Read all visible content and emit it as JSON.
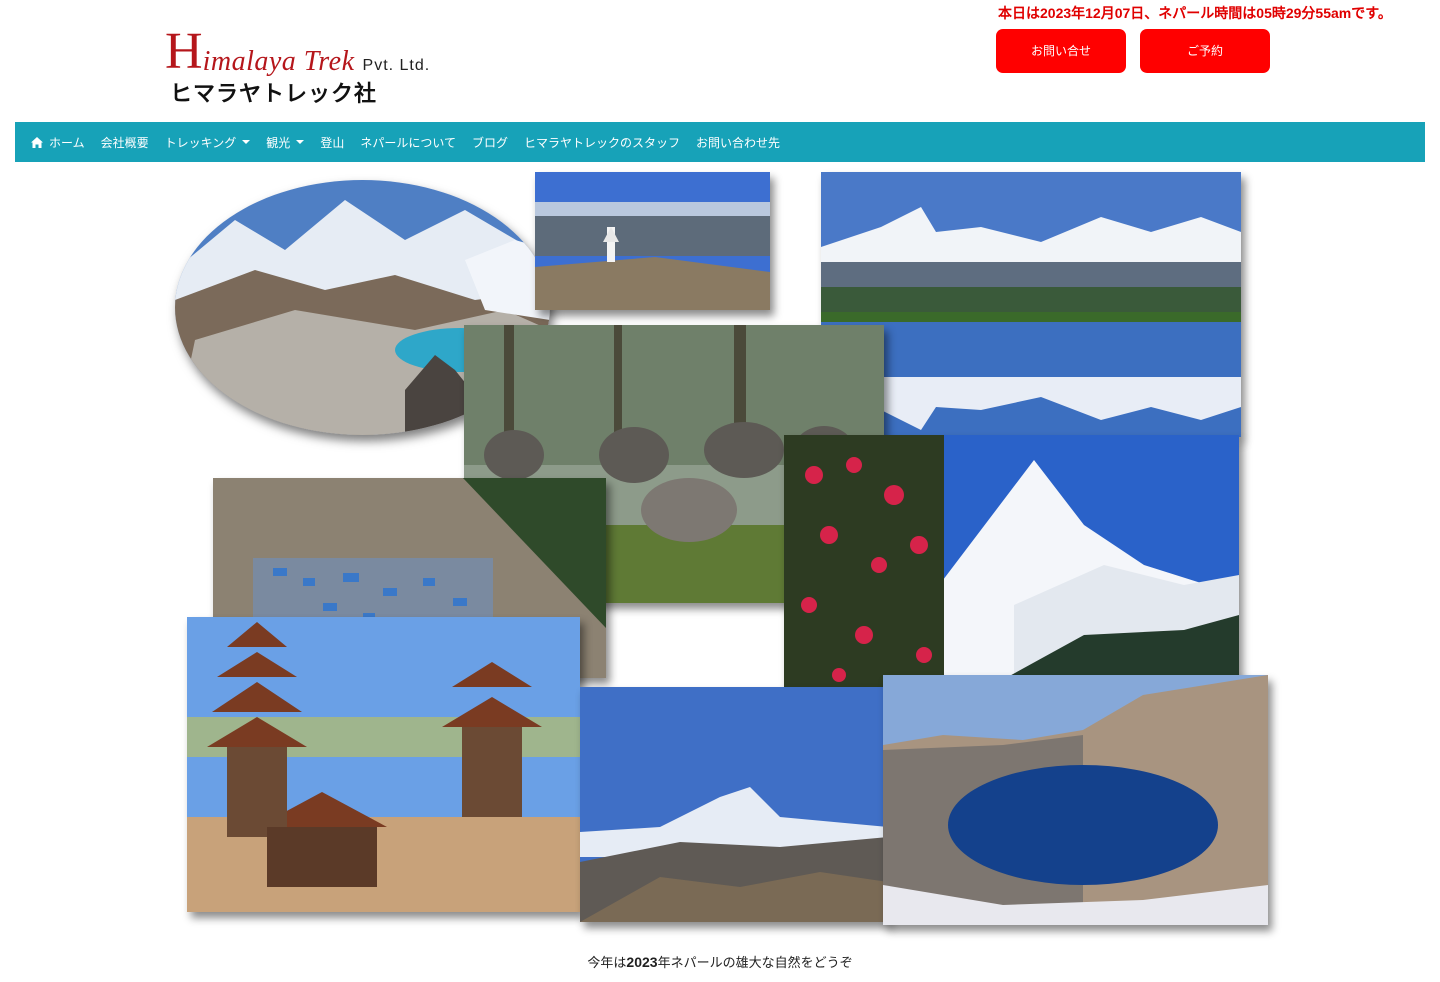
{
  "header": {
    "logo_initial": "H",
    "logo_rest": "imalaya Trek",
    "logo_suffix": "Pvt. Ltd.",
    "logo_japanese": "ヒマラヤトレック社",
    "date_line": "本日は2023年12月07日、ネパール時間は05時29分55amです。",
    "button_primary": "お問い合せ",
    "button_secondary": "ご予約"
  },
  "nav": {
    "items": [
      {
        "label": "ホーム",
        "icon": "home-icon"
      },
      {
        "label": "会社概要",
        "dropdown": false
      },
      {
        "label": "トレッキング",
        "dropdown": true
      },
      {
        "label": "観光",
        "dropdown": true
      },
      {
        "label": "登山",
        "dropdown": false
      },
      {
        "label": "ネパールについて",
        "dropdown": false
      },
      {
        "label": "ブログ",
        "dropdown": false
      },
      {
        "label": "ヒマラヤトレックのスタッフ",
        "dropdown": false
      },
      {
        "label": "お問い合わせ先",
        "dropdown": false
      }
    ]
  },
  "footer": {
    "caption_prefix": "今年は",
    "caption_year": "2023",
    "caption_suffix": "年ネパールの雄大な自然をどうぞ"
  },
  "colors": {
    "nav_bg": "#17a2b8",
    "button_red": "#ff0000",
    "brand_red": "#b5161b"
  }
}
